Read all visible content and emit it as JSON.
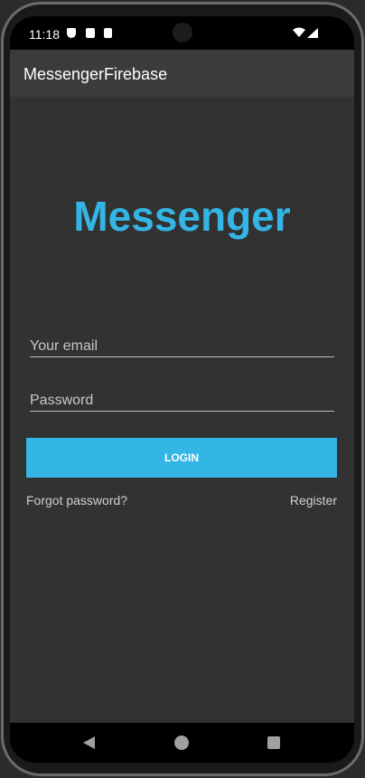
{
  "status_bar": {
    "time": "11:18"
  },
  "app_bar": {
    "title": "MessengerFirebase"
  },
  "main": {
    "logo": "Messenger",
    "email_placeholder": "Your email",
    "password_placeholder": "Password",
    "login_label": "LOGIN",
    "forgot_label": "Forgot password?",
    "register_label": "Register"
  },
  "colors": {
    "accent": "#33b5e5",
    "background": "#323232",
    "app_bar": "#3c3b3c"
  }
}
